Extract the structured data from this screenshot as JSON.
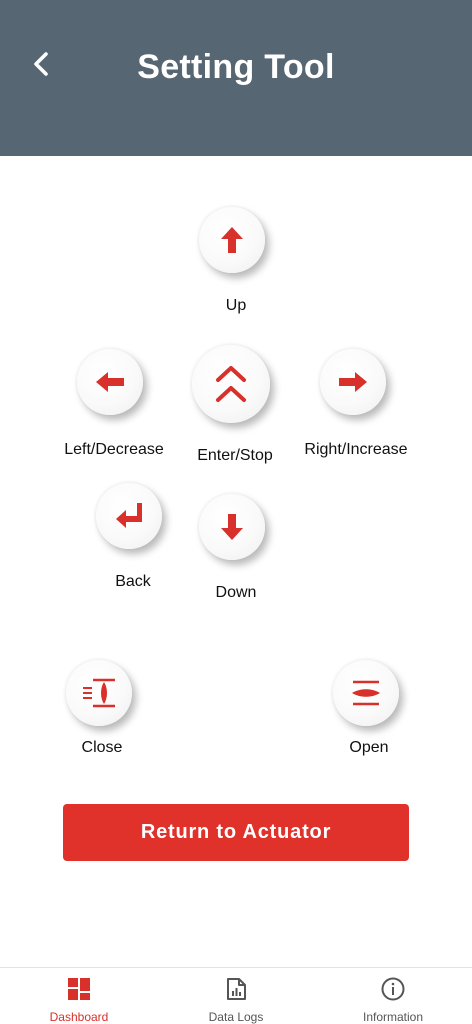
{
  "header": {
    "title": "Setting Tool",
    "back_icon": "chevron-left-icon"
  },
  "controls": {
    "up": {
      "label": "Up",
      "icon": "arrow-up-icon"
    },
    "left": {
      "label": "Left/Decrease",
      "icon": "arrow-left-icon"
    },
    "enter": {
      "label": "Enter/Stop",
      "icon": "double-chevron-up-down-icon"
    },
    "right": {
      "label": "Right/Increase",
      "icon": "arrow-right-icon"
    },
    "back": {
      "label": "Back",
      "icon": "return-arrow-icon"
    },
    "down": {
      "label": "Down",
      "icon": "arrow-down-icon"
    },
    "close": {
      "label": "Close",
      "icon": "valve-close-icon"
    },
    "open": {
      "label": "Open",
      "icon": "valve-open-icon"
    }
  },
  "action": {
    "return_label": "Return to Actuator"
  },
  "bottom_nav": {
    "items": [
      {
        "label": "Dashboard",
        "icon": "dashboard-icon",
        "active": true
      },
      {
        "label": "Data Logs",
        "icon": "data-logs-icon",
        "active": false
      },
      {
        "label": "Information",
        "icon": "info-icon",
        "active": false
      }
    ]
  },
  "colors": {
    "header_bg": "#576673",
    "accent": "#d8312b",
    "button_bg": "#e0312b"
  }
}
